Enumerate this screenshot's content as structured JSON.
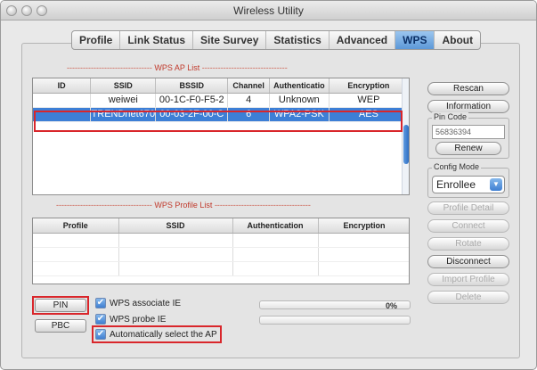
{
  "window": {
    "title": "Wireless Utility"
  },
  "tabs": [
    {
      "label": "Profile",
      "active": false
    },
    {
      "label": "Link Status",
      "active": false
    },
    {
      "label": "Site Survey",
      "active": false
    },
    {
      "label": "Statistics",
      "active": false
    },
    {
      "label": "Advanced",
      "active": false
    },
    {
      "label": "WPS",
      "active": true
    },
    {
      "label": "About",
      "active": false
    }
  ],
  "ap_list": {
    "label": "WPS AP List",
    "columns": [
      "ID",
      "SSID",
      "BSSID",
      "Channel",
      "Authenticatio",
      "Encryption"
    ],
    "rows": [
      {
        "id": "",
        "ssid": "weiwei",
        "bssid": "00-1C-F0-F5-2",
        "channel": "4",
        "auth": "Unknown",
        "enc": "WEP"
      },
      {
        "id": "",
        "ssid": "TRENDnet670",
        "bssid": "00-03-2F-00-C",
        "channel": "6",
        "auth": "WPA2-PSK",
        "enc": "AES",
        "selected": true
      }
    ]
  },
  "profile_list": {
    "label": "WPS Profile List",
    "columns": [
      "Profile",
      "SSID",
      "Authentication",
      "Encryption"
    ]
  },
  "right_panel": {
    "rescan": "Rescan",
    "information": "Information",
    "pin_code_label": "Pin Code",
    "pin_code_value": "56836394",
    "renew": "Renew",
    "config_mode_label": "Config Mode",
    "config_mode_value": "Enrollee",
    "profile_detail": "Profile Detail",
    "connect": "Connect",
    "rotate": "Rotate",
    "disconnect": "Disconnect",
    "import_profile": "Import Profile",
    "delete": "Delete"
  },
  "bottom": {
    "pin_button": "PIN",
    "pbc_button": "PBC",
    "wps_associate_ie": "WPS associate IE",
    "wps_probe_ie": "WPS probe IE",
    "auto_select_ap": "Automatically select the AP",
    "progress_percent": "0%",
    "progress_value": 0
  },
  "colors": {
    "selection": "#3d7fd6",
    "highlight_box": "#d9262b",
    "active_tab": "#5c98d8"
  }
}
